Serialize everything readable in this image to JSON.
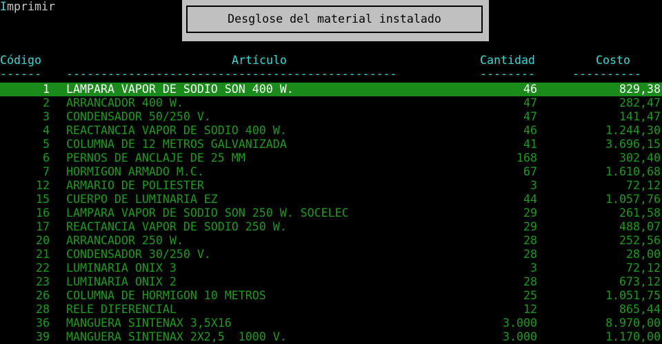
{
  "menu": {
    "hotkey": "I",
    "label_rest": "mprimir"
  },
  "title": "Desglose del material instalado",
  "columns": {
    "code": "Código",
    "article": "Artículo",
    "quantity": "Cantidad",
    "cost": "Costo"
  },
  "separators": {
    "code": "------",
    "article": "------------------------------------------------",
    "quantity": "--------",
    "cost": "----------"
  },
  "colors": {
    "text": "#1e9a1e",
    "selected_background": "#1a8a1a",
    "header": "#38d8d8",
    "dialog": "#c0c0c0"
  },
  "selected_index": 0,
  "rows": [
    {
      "code": "1",
      "article": "LAMPARA VAPOR DE SODIO SON 400 W.",
      "quantity": "46",
      "cost": "829,38"
    },
    {
      "code": "2",
      "article": "ARRANCADOR 400 W.",
      "quantity": "47",
      "cost": "282,47"
    },
    {
      "code": "3",
      "article": "CONDENSADOR 50/250 V.",
      "quantity": "47",
      "cost": "141,47"
    },
    {
      "code": "4",
      "article": "REACTANCIA VAPOR DE SODIO 400 W.",
      "quantity": "46",
      "cost": "1.244,30"
    },
    {
      "code": "5",
      "article": "COLUMNA DE 12 METROS GALVANIZADA",
      "quantity": "41",
      "cost": "3.696,15"
    },
    {
      "code": "6",
      "article": "PERNOS DE ANCLAJE DE 25 MM",
      "quantity": "168",
      "cost": "302,40"
    },
    {
      "code": "7",
      "article": "HORMIGON ARMADO M.C.",
      "quantity": "67",
      "cost": "1.610,68"
    },
    {
      "code": "12",
      "article": "ARMARIO DE POLIESTER",
      "quantity": "3",
      "cost": "72,12"
    },
    {
      "code": "15",
      "article": "CUERPO DE LUMINARIA EZ",
      "quantity": "44",
      "cost": "1.057,76"
    },
    {
      "code": "16",
      "article": "LAMPARA VAPOR DE SODIO SON 250 W. SOCELEC",
      "quantity": "29",
      "cost": "261,58"
    },
    {
      "code": "17",
      "article": "REACTANCIA VAPOR DE SODIO 250 W.",
      "quantity": "29",
      "cost": "488,07"
    },
    {
      "code": "20",
      "article": "ARRANCADOR 250 W.",
      "quantity": "28",
      "cost": "252,56"
    },
    {
      "code": "21",
      "article": "CONDENSADOR 30/250 V.",
      "quantity": "28",
      "cost": "28,00"
    },
    {
      "code": "22",
      "article": "LUMINARIA ONIX 3",
      "quantity": "3",
      "cost": "72,12"
    },
    {
      "code": "23",
      "article": "LUMINARIA ONIX 2",
      "quantity": "28",
      "cost": "673,12"
    },
    {
      "code": "26",
      "article": "COLUMNA DE HORMIGON 10 METROS",
      "quantity": "25",
      "cost": "1.051,75"
    },
    {
      "code": "28",
      "article": "RELE DIFERENCIAL",
      "quantity": "12",
      "cost": "865,44"
    },
    {
      "code": "36",
      "article": "MANGUERA SINTENAX 3,5X16",
      "quantity": "3.000",
      "cost": "8.970,00"
    },
    {
      "code": "39",
      "article": "MANGUERA SINTENAX 2X2,5  1000 V.",
      "quantity": "3.000",
      "cost": "1.170,00"
    }
  ]
}
